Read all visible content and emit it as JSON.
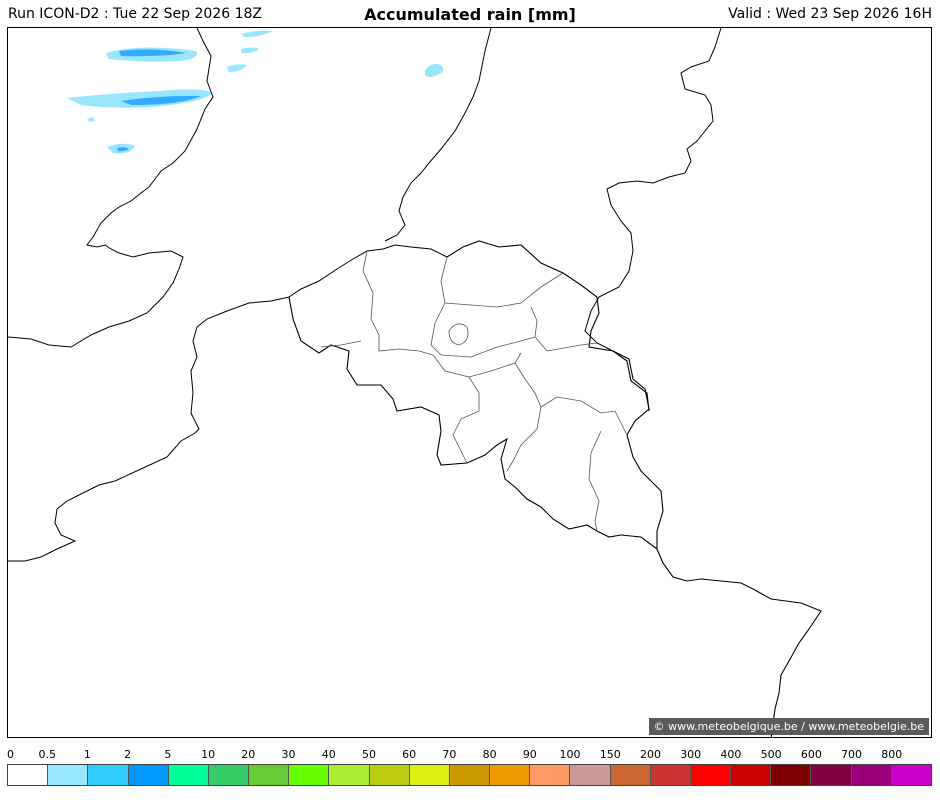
{
  "header": {
    "run": "Run ICON-D2 : Tue 22 Sep 2026 18Z",
    "title": "Accumulated rain [mm]",
    "valid": "Valid : Wed 23 Sep 2026 16H"
  },
  "credit": "© www.meteobelgique.be / www.meteobelgie.be",
  "legend": {
    "ticks": [
      "0",
      "0.5",
      "1",
      "2",
      "5",
      "10",
      "20",
      "30",
      "40",
      "50",
      "60",
      "70",
      "80",
      "90",
      "100",
      "150",
      "200",
      "300",
      "400",
      "500",
      "600",
      "700",
      "800"
    ],
    "colors": [
      "#ffffff",
      "#99e6ff",
      "#33ccff",
      "#0099ff",
      "#00ff99",
      "#33cc66",
      "#66cc33",
      "#66ff00",
      "#aaee33",
      "#bbcc11",
      "#ddee11",
      "#cc9900",
      "#ee9900",
      "#ff9966",
      "#cc9999",
      "#cc6633",
      "#cc3333",
      "#ff0000",
      "#cc0000",
      "#800000",
      "#800040",
      "#990077",
      "#cc00cc"
    ]
  }
}
